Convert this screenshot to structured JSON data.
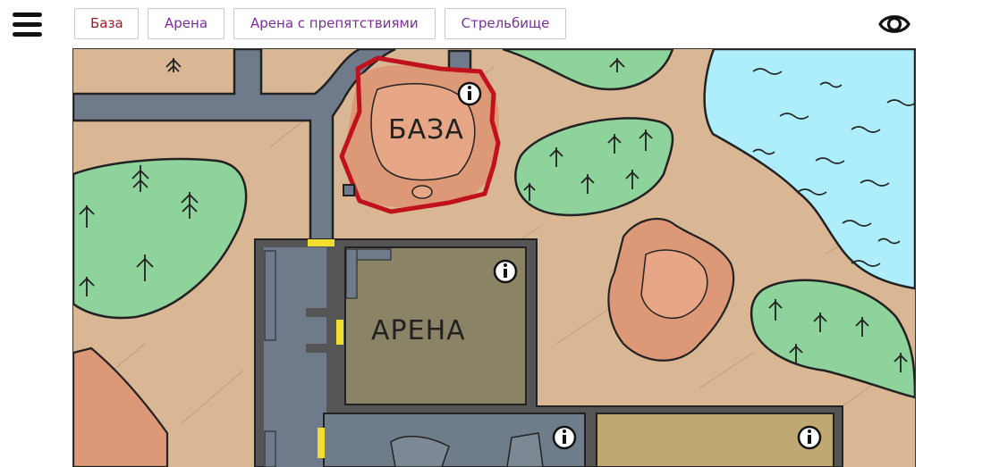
{
  "header": {
    "menu_icon": "hamburger-menu-icon",
    "tabs": [
      {
        "label": "База",
        "active": true
      },
      {
        "label": "Арена",
        "active": false
      },
      {
        "label": "Арена с препятствиями",
        "active": false
      },
      {
        "label": "Стрельбище",
        "active": false
      }
    ],
    "visibility_icon": "eye-icon"
  },
  "map": {
    "zones": [
      {
        "label": "БАЗА",
        "selected": true
      },
      {
        "label": "АРЕНА",
        "selected": false
      }
    ],
    "info_icon": "info-icon",
    "colors": {
      "ground": "#d9b694",
      "forest": "#8fd39c",
      "water": "#aeeefa",
      "rock": "#dc9877",
      "road": "#6f7a8b",
      "arena_floor": "#8a8366",
      "obstacle_floor": "#6f7c8a",
      "range_floor": "#bfa872",
      "selection": "#c0121c",
      "gate": "#f1df30"
    }
  }
}
